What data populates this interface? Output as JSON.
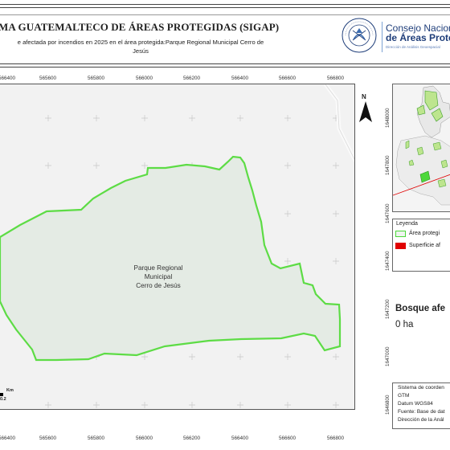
{
  "header": {
    "title": "MA GUATEMALTECO DE ÁREAS PROTEGIDAS  (SIGAP)",
    "subtitle_line1": "e afectada por incendios en 2025 en el área protegida:Parque Regional Municipal Cerro de",
    "subtitle_line2": "Jesús"
  },
  "logo": {
    "line1": "Consejo Nacional",
    "line2": "de Áreas Protegid",
    "line3": "Dirección de Análisis Geoespacial",
    "seal_top_text": "GOBIERNO DE LA REPÚBLICA",
    "seal_bottom_text": "GUATEMALA"
  },
  "map": {
    "area_label_lines": [
      "Parque Regional",
      "Municipal",
      "Cerro de Jesús"
    ],
    "x_ticks": [
      "566400",
      "565600",
      "565800",
      "566000",
      "566200",
      "566400",
      "566600",
      "566800"
    ],
    "y_ticks": [
      "1648000",
      "1647800",
      "1647600",
      "1647400",
      "1647200",
      "1647000",
      "1646800"
    ],
    "north_arrow": "N",
    "scale_units": "Km",
    "scale_value": "0.2",
    "colors": {
      "boundary": "#4cd83a",
      "fill": "#e6ece6",
      "background": "#f2f2f2",
      "burned": "#e00000"
    }
  },
  "legend": {
    "title": "Leyenda",
    "items": [
      {
        "label": "Área protegi",
        "color": "#4cd83a"
      },
      {
        "label": "Superficie af",
        "color": "#e00000"
      }
    ]
  },
  "summary": {
    "heading": "Bosque afe",
    "value": "0 ha"
  },
  "info": {
    "lines": [
      "Sistema de coorden",
      "GTM",
      "Datum WGS84",
      "Fuente: Base de dat",
      "Dirección de la Anál"
    ]
  }
}
